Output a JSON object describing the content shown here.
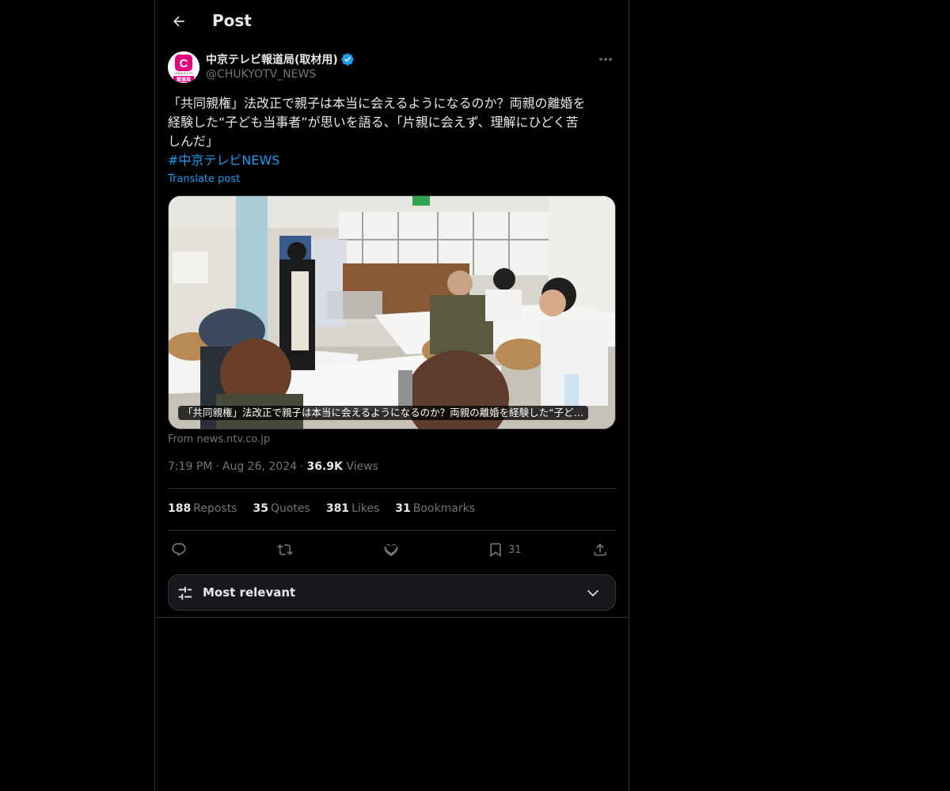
{
  "header": {
    "title": "Post"
  },
  "author": {
    "display_name": "中京テレビ報道局(取材用)",
    "handle": "@CHUKYOTV_NEWS",
    "avatar_text_top": "CHUKYO TV",
    "avatar_text_bottom": "報道局",
    "avatar_letter": "C"
  },
  "post": {
    "lines": [
      "「共同親権」法改正で親子は本当に会えるようになるのか？両親の離婚を",
      "経験した“子ども当事者”が思いを語る、「片親に会えず、理解にひどく苦",
      "しんだ」"
    ],
    "hashtag": "#中京テレビNEWS",
    "translate_label": "Translate post"
  },
  "card": {
    "caption": "「共同親権」法改正で親子は本当に会えるようになるのか？両親の離婚を経験した“子ど…",
    "source": "From news.ntv.co.jp"
  },
  "meta": {
    "time": "7:19 PM",
    "date": "Aug 26, 2024",
    "views_count": "36.9K",
    "views_label": "Views"
  },
  "stats": {
    "reposts": {
      "count": "188",
      "label": "Reposts"
    },
    "quotes": {
      "count": "35",
      "label": "Quotes"
    },
    "likes": {
      "count": "381",
      "label": "Likes"
    },
    "bookmarks": {
      "count": "31",
      "label": "Bookmarks"
    }
  },
  "actions": {
    "bookmark_count": "31",
    "icons": [
      "reply-icon",
      "repost-icon",
      "like-icon",
      "bookmark-icon",
      "share-icon"
    ]
  },
  "sort": {
    "label": "Most relevant"
  },
  "colors": {
    "background": "#000000",
    "text": "#e7e9ea",
    "muted": "#71767b",
    "accent": "#1d9bf0",
    "border": "#2f3336",
    "brand_pink": "#e4007f"
  }
}
